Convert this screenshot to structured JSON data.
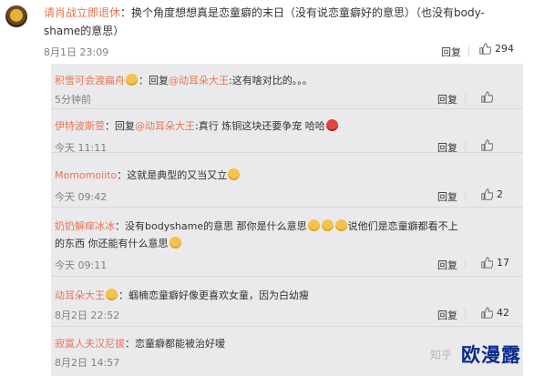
{
  "main_comment": {
    "username": "请肖战立即退休",
    "text_line1": "：换个角度想想真是恋童癖的末日（没有说恋童癖好的意思）（也没有body-",
    "text_line2": "shame的意思）",
    "time": "8月1日 23:09",
    "reply_label": "回复",
    "likes": "294"
  },
  "replies": [
    {
      "username": "积雪可会渡扁舟",
      "text_line1": "：回复",
      "mention": "@动耳朵大王",
      "text_after": ":这有啥对比的。。。",
      "time": "5分钟前",
      "reply_label": "回复",
      "likes": ""
    },
    {
      "username": "伊特波斯萱",
      "text_line1": "：回复",
      "mention": "@动耳朵大王",
      "text_after": ":真行 炼铜这块还要争宠 哈哈",
      "time": "今天 11:11",
      "reply_label": "回复",
      "likes": ""
    },
    {
      "username": "Momomoiito",
      "text_line1": "：这就是典型的又当又立",
      "time": "今天 09:42",
      "reply_label": "回复",
      "likes": "2"
    },
    {
      "username": "奶奶解痒冰冰",
      "text_line1": "：没有bodyshame的意思 那你是什么意思",
      "text_after": "说他们是恋童癖都看不上",
      "text_line2": "的东西 你还能有什么意思",
      "time": "今天 09:11",
      "reply_label": "回复",
      "likes": "17"
    },
    {
      "username": "动耳朵大王",
      "text_line1": "：蝈楠恋童癖好像更喜欢女童，因为白幼瘦",
      "time": "8月2日 22:52",
      "reply_label": "回复",
      "likes": "42"
    },
    {
      "username": "寂寞人夫汉尼拔",
      "text_line1": "：恋童癖都能被治好嗳",
      "time": "8月2日 14:57",
      "reply_label": "回复",
      "likes": ""
    }
  ],
  "watermark": {
    "small": "知乎",
    "big": "欧漫露"
  },
  "colors": {
    "username": "#eb7350",
    "reply_bg": "#eaeaec",
    "watermark_big": "#0b2a8a"
  }
}
